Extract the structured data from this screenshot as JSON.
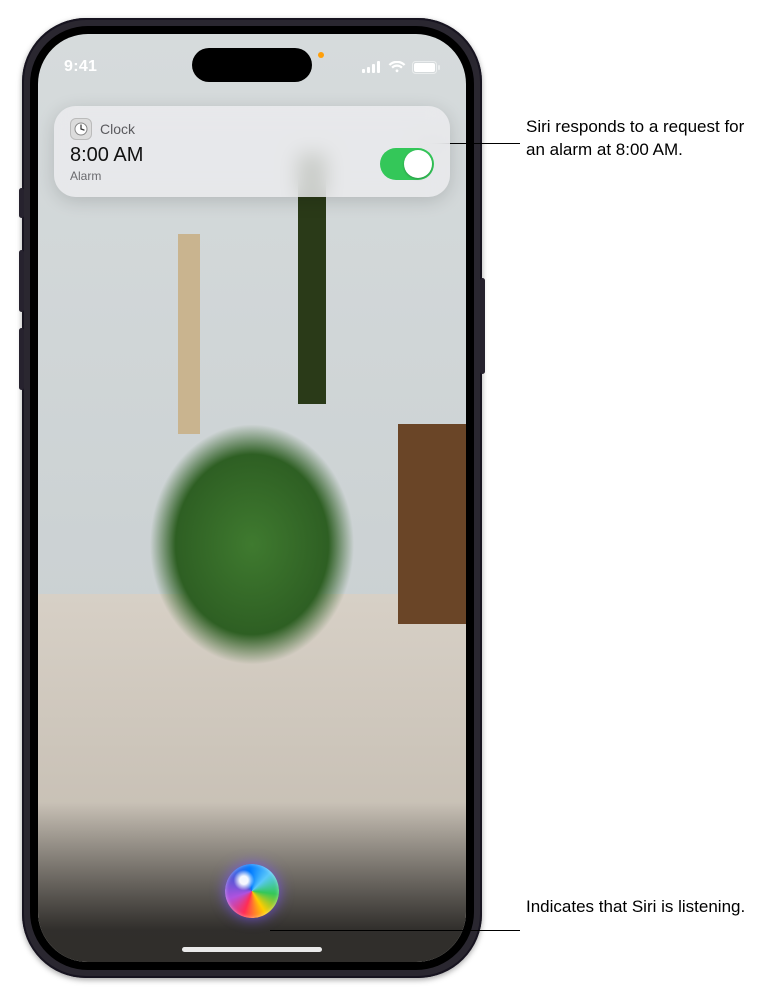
{
  "status_bar": {
    "time": "9:41"
  },
  "notification": {
    "app_name": "Clock",
    "time": "8:00 AM",
    "label": "Alarm",
    "toggle_on": true
  },
  "siri": {
    "state": "listening"
  },
  "callouts": {
    "alarm": "Siri responds to a request for an alarm at 8:00 AM.",
    "orb": "Indicates that Siri is listening."
  }
}
